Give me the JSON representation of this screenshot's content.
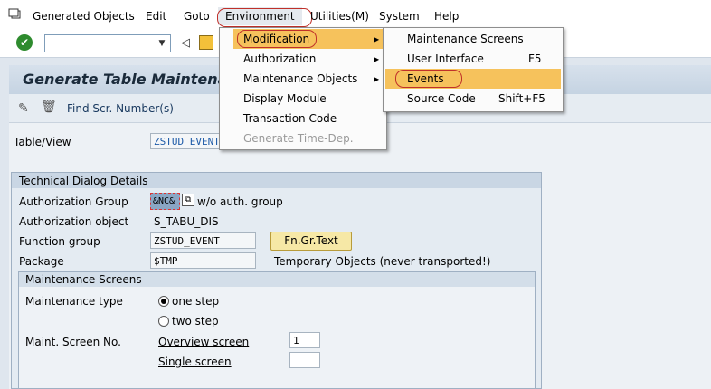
{
  "menubar": {
    "items": [
      "Generated Objects",
      "Edit",
      "Goto",
      "Environment",
      "Utilities(M)",
      "System",
      "Help"
    ]
  },
  "toolbar": {
    "command_value": "",
    "drop_glyph": "▼"
  },
  "title": "Generate Table Maintena",
  "apptoolbar": {
    "find_label": "Find Scr. Number(s)"
  },
  "form": {
    "table_view_label": "Table/View",
    "table_view_value": "ZSTUD_EVENT",
    "tech_group_title": "Technical Dialog Details",
    "auth_group_label": "Authorization Group",
    "auth_group_value": "&NC&",
    "auth_group_desc": "w/o auth. group",
    "auth_object_label": "Authorization object",
    "auth_object_value": "S_TABU_DIS",
    "function_group_label": "Function group",
    "function_group_value": "ZSTUD_EVENT",
    "fngr_button": "Fn.Gr.Text",
    "package_label": "Package",
    "package_value": "$TMP",
    "package_desc": "Temporary Objects (never transported!)",
    "maint_screens_title": "Maintenance Screens",
    "maint_type_label": "Maintenance type",
    "one_step": "one step",
    "two_step": "two step",
    "maint_screen_no_label": "Maint. Screen No.",
    "overview_screen_label": "Overview screen",
    "overview_screen_value": "1",
    "single_screen_label": "Single screen",
    "single_screen_value": ""
  },
  "environment_menu": {
    "items": [
      "Modification",
      "Authorization",
      "Maintenance Objects",
      "Display Module",
      "Transaction Code",
      "Generate Time-Dep."
    ]
  },
  "modification_menu": {
    "items": [
      {
        "label": "Maintenance Screens",
        "shortcut": ""
      },
      {
        "label": "User Interface",
        "shortcut": "F5"
      },
      {
        "label": "Events",
        "shortcut": ""
      },
      {
        "label": "Source Code",
        "shortcut": "Shift+F5"
      }
    ]
  },
  "colors": {
    "highlight": "#f6c25c",
    "annotation": "#c0302a",
    "field_text": "#1e5ba8"
  }
}
